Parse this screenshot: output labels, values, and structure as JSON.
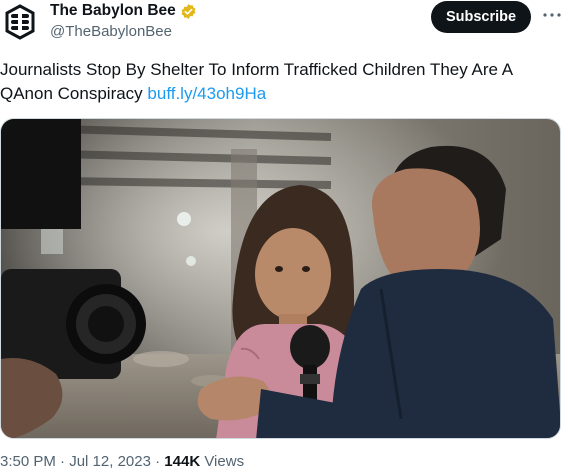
{
  "author": {
    "display_name": "The Babylon Bee",
    "handle": "@TheBabylonBee",
    "verified_icon": "verified-badge-icon",
    "logo_icon": "babylon-bee-logo-icon"
  },
  "actions": {
    "subscribe_label": "Subscribe",
    "more_icon": "more-options-icon"
  },
  "tweet": {
    "text": "Journalists Stop By Shelter To Inform Trafficked Children They Are A QAnon Conspiracy ",
    "link": "buff.ly/43oh9Ha"
  },
  "media": {
    "alt": ""
  },
  "meta": {
    "time": "3:50 PM",
    "separator": " · ",
    "date": "Jul 12, 2023",
    "views_count": "144K",
    "views_label": " Views"
  },
  "colors": {
    "text": "#0f1419",
    "secondary": "#536471",
    "link": "#1d9bf0",
    "verified_gold": "#e2b719",
    "button": "#0f1419"
  }
}
